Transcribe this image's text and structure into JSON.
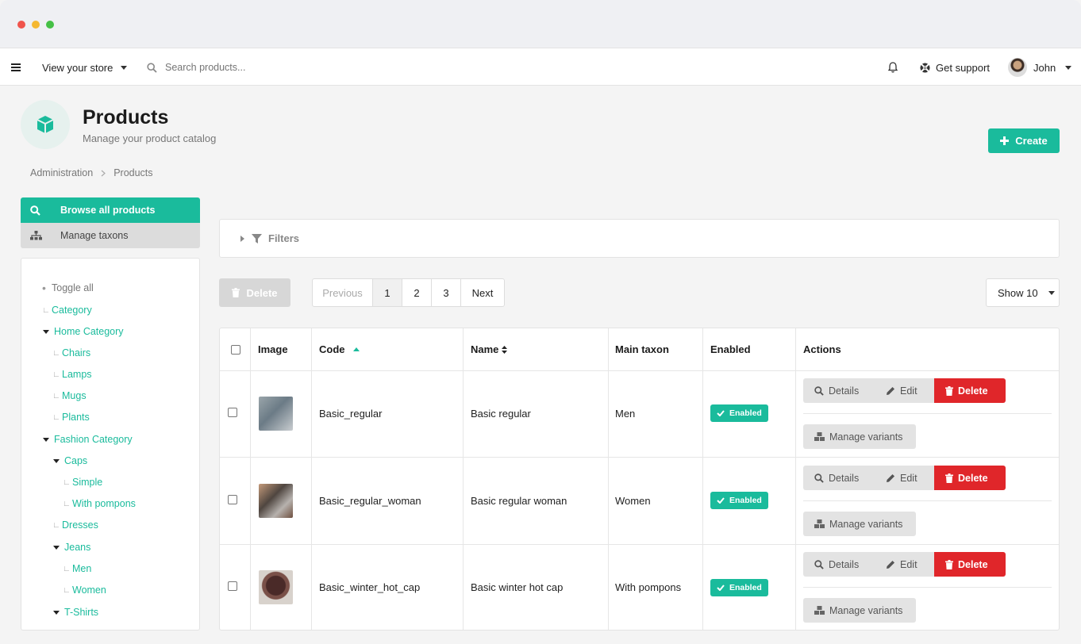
{
  "topbar": {
    "view_store": "View your store",
    "search_placeholder": "Search products...",
    "support": "Get support",
    "user": "John"
  },
  "header": {
    "title": "Products",
    "subtitle": "Manage your product catalog",
    "create_label": "Create"
  },
  "breadcrumb": [
    "Administration",
    "Products"
  ],
  "sidebar": {
    "items": [
      {
        "label": "Browse all products"
      },
      {
        "label": "Manage taxons"
      }
    ]
  },
  "tree": {
    "toggle_all": "Toggle all",
    "items": [
      {
        "label": "Category",
        "level": 0,
        "expanded": false
      },
      {
        "label": "Home Category",
        "level": 0,
        "expanded": true
      },
      {
        "label": "Chairs",
        "level": 1,
        "expanded": false
      },
      {
        "label": "Lamps",
        "level": 1,
        "expanded": false
      },
      {
        "label": "Mugs",
        "level": 1,
        "expanded": false
      },
      {
        "label": "Plants",
        "level": 1,
        "expanded": false
      },
      {
        "label": "Fashion Category",
        "level": 0,
        "expanded": true
      },
      {
        "label": "Caps",
        "level": 1,
        "expanded": true
      },
      {
        "label": "Simple",
        "level": 2,
        "expanded": false
      },
      {
        "label": "With pompons",
        "level": 2,
        "expanded": false
      },
      {
        "label": "Dresses",
        "level": 1,
        "expanded": false
      },
      {
        "label": "Jeans",
        "level": 1,
        "expanded": true
      },
      {
        "label": "Men",
        "level": 2,
        "expanded": false
      },
      {
        "label": "Women",
        "level": 2,
        "expanded": false
      },
      {
        "label": "T-Shirts",
        "level": 1,
        "expanded": true
      }
    ]
  },
  "filters": {
    "label": "Filters"
  },
  "toolbar": {
    "delete_label": "Delete",
    "pagination": {
      "previous": "Previous",
      "pages": [
        "1",
        "2",
        "3"
      ],
      "next": "Next",
      "current": "1"
    },
    "show_label": "Show 10"
  },
  "table": {
    "columns": [
      "Image",
      "Code",
      "Name",
      "Main taxon",
      "Enabled",
      "Actions"
    ],
    "rows": [
      {
        "code": "Basic_regular",
        "name": "Basic regular",
        "taxon": "Men",
        "enabled": "Enabled",
        "thumb_color": "#7f8f99"
      },
      {
        "code": "Basic_regular_woman",
        "name": "Basic regular woman",
        "taxon": "Women",
        "enabled": "Enabled",
        "thumb_color": "#8a6b55"
      },
      {
        "code": "Basic_winter_hot_cap",
        "name": "Basic winter hot cap",
        "taxon": "With pompons",
        "enabled": "Enabled",
        "thumb_color": "#5a3b35"
      }
    ],
    "actions": {
      "details": "Details",
      "edit": "Edit",
      "delete": "Delete",
      "variants": "Manage variants"
    }
  },
  "colors": {
    "accent": "#1abb9c",
    "danger": "#e0262a"
  }
}
